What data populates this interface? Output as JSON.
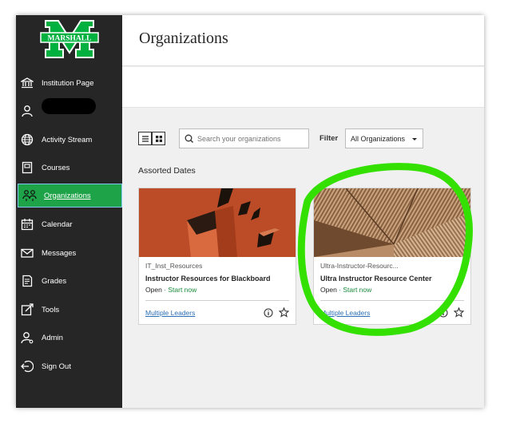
{
  "logo": {
    "text": "MARSHALL",
    "colors": {
      "green": "#00b140",
      "white": "#ffffff"
    }
  },
  "sidebar": {
    "items": [
      {
        "label": "Institution Page",
        "icon": "institution-icon"
      },
      {
        "label": "",
        "icon": "user-icon"
      },
      {
        "label": "Activity Stream",
        "icon": "globe-icon"
      },
      {
        "label": "Courses",
        "icon": "courses-icon"
      },
      {
        "label": "Organizations",
        "icon": "organizations-icon",
        "active": true
      },
      {
        "label": "Calendar",
        "icon": "calendar-icon"
      },
      {
        "label": "Messages",
        "icon": "envelope-icon"
      },
      {
        "label": "Grades",
        "icon": "grades-icon"
      },
      {
        "label": "Tools",
        "icon": "tools-icon"
      },
      {
        "label": "Admin",
        "icon": "admin-icon"
      },
      {
        "label": "Sign Out",
        "icon": "sign-out-icon"
      }
    ],
    "active_color": "#1fa349"
  },
  "header": {
    "title": "Organizations"
  },
  "toolbar": {
    "search_placeholder": "Search your organizations",
    "filter_label": "Filter",
    "filter_value": "All Organizations"
  },
  "section": {
    "title": "Assorted Dates"
  },
  "cards": [
    {
      "code": "IT_Inst_Resources",
      "name": "Instructor Resources for Blackboard",
      "status": "Open",
      "start": "· Start now",
      "leaders": "Multiple Leaders"
    },
    {
      "code": "Ultra-Instructor-Resourc...",
      "name": "Ultra Instructor Resource Center",
      "status": "Open",
      "start": "· Start now",
      "leaders": "Multiple Leaders"
    }
  ],
  "annotation": {
    "color": "#33e000"
  }
}
